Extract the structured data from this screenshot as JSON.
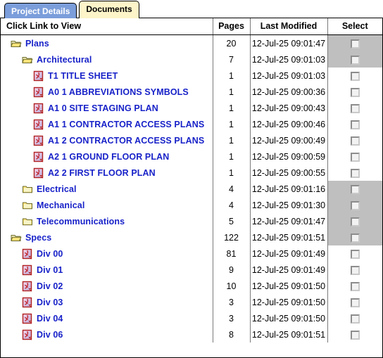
{
  "tabs": [
    {
      "label": "Project Details",
      "active": false
    },
    {
      "label": "Documents",
      "active": true
    }
  ],
  "table": {
    "headers": {
      "name": "Click Link to View",
      "pages": "Pages",
      "modified": "Last Modified",
      "select": "Select"
    },
    "rows": [
      {
        "name": "Plans",
        "icon": "folder-open-icon",
        "indent": 0,
        "type": "folder",
        "pages": "20",
        "modified": "12-Jul-25 09:01:47",
        "shaded": true
      },
      {
        "name": "Architectural",
        "icon": "folder-open-icon",
        "indent": 1,
        "type": "folder",
        "pages": "7",
        "modified": "12-Jul-25 09:01:03",
        "shaded": true
      },
      {
        "name": "T1 TITLE SHEET",
        "icon": "pdf-file-icon",
        "indent": 2,
        "type": "file",
        "pages": "1",
        "modified": "12-Jul-25 09:01:03",
        "shaded": false
      },
      {
        "name": "A0 1 ABBREVIATIONS SYMBOLS",
        "icon": "pdf-file-icon",
        "indent": 2,
        "type": "file",
        "pages": "1",
        "modified": "12-Jul-25 09:00:36",
        "shaded": false
      },
      {
        "name": "A1 0 SITE STAGING PLAN",
        "icon": "pdf-file-icon",
        "indent": 2,
        "type": "file",
        "pages": "1",
        "modified": "12-Jul-25 09:00:43",
        "shaded": false
      },
      {
        "name": "A1 1 CONTRACTOR ACCESS PLANS",
        "icon": "pdf-file-icon",
        "indent": 2,
        "type": "file",
        "pages": "1",
        "modified": "12-Jul-25 09:00:46",
        "shaded": false
      },
      {
        "name": "A1 2 CONTRACTOR ACCESS PLANS",
        "icon": "pdf-file-icon",
        "indent": 2,
        "type": "file",
        "pages": "1",
        "modified": "12-Jul-25 09:00:49",
        "shaded": false
      },
      {
        "name": "A2 1 GROUND FLOOR PLAN",
        "icon": "pdf-file-icon",
        "indent": 2,
        "type": "file",
        "pages": "1",
        "modified": "12-Jul-25 09:00:59",
        "shaded": false
      },
      {
        "name": "A2 2 FIRST FLOOR PLAN",
        "icon": "pdf-file-icon",
        "indent": 2,
        "type": "file",
        "pages": "1",
        "modified": "12-Jul-25 09:00:55",
        "shaded": false
      },
      {
        "name": "Electrical",
        "icon": "folder-closed-icon",
        "indent": 1,
        "type": "folder",
        "pages": "4",
        "modified": "12-Jul-25 09:01:16",
        "shaded": true
      },
      {
        "name": "Mechanical",
        "icon": "folder-closed-icon",
        "indent": 1,
        "type": "folder",
        "pages": "4",
        "modified": "12-Jul-25 09:01:30",
        "shaded": true
      },
      {
        "name": "Telecommunications",
        "icon": "folder-closed-icon",
        "indent": 1,
        "type": "folder",
        "pages": "5",
        "modified": "12-Jul-25 09:01:47",
        "shaded": true
      },
      {
        "name": "Specs",
        "icon": "folder-open-icon",
        "indent": 0,
        "type": "folder",
        "pages": "122",
        "modified": "12-Jul-25 09:01:51",
        "shaded": true
      },
      {
        "name": "Div 00",
        "icon": "pdf-file-icon",
        "indent": 1,
        "type": "file",
        "pages": "81",
        "modified": "12-Jul-25 09:01:49",
        "shaded": false
      },
      {
        "name": "Div 01",
        "icon": "pdf-file-icon",
        "indent": 1,
        "type": "file",
        "pages": "9",
        "modified": "12-Jul-25 09:01:49",
        "shaded": false
      },
      {
        "name": "Div 02",
        "icon": "pdf-file-icon",
        "indent": 1,
        "type": "file",
        "pages": "10",
        "modified": "12-Jul-25 09:01:50",
        "shaded": false
      },
      {
        "name": "Div 03",
        "icon": "pdf-file-icon",
        "indent": 1,
        "type": "file",
        "pages": "3",
        "modified": "12-Jul-25 09:01:50",
        "shaded": false
      },
      {
        "name": "Div 04",
        "icon": "pdf-file-icon",
        "indent": 1,
        "type": "file",
        "pages": "3",
        "modified": "12-Jul-25 09:01:50",
        "shaded": false
      },
      {
        "name": "Div 06",
        "icon": "pdf-file-icon",
        "indent": 1,
        "type": "file",
        "pages": "8",
        "modified": "12-Jul-25 09:01:51",
        "shaded": false
      }
    ]
  },
  "colors": {
    "tab_active_bg": "#fdf5c9",
    "tab_inactive_bg": "#7b9edb",
    "link": "#1822c8",
    "row_shade": "#bfbfbf",
    "folder": "#ffd95a",
    "pdf": "#c0392b"
  }
}
